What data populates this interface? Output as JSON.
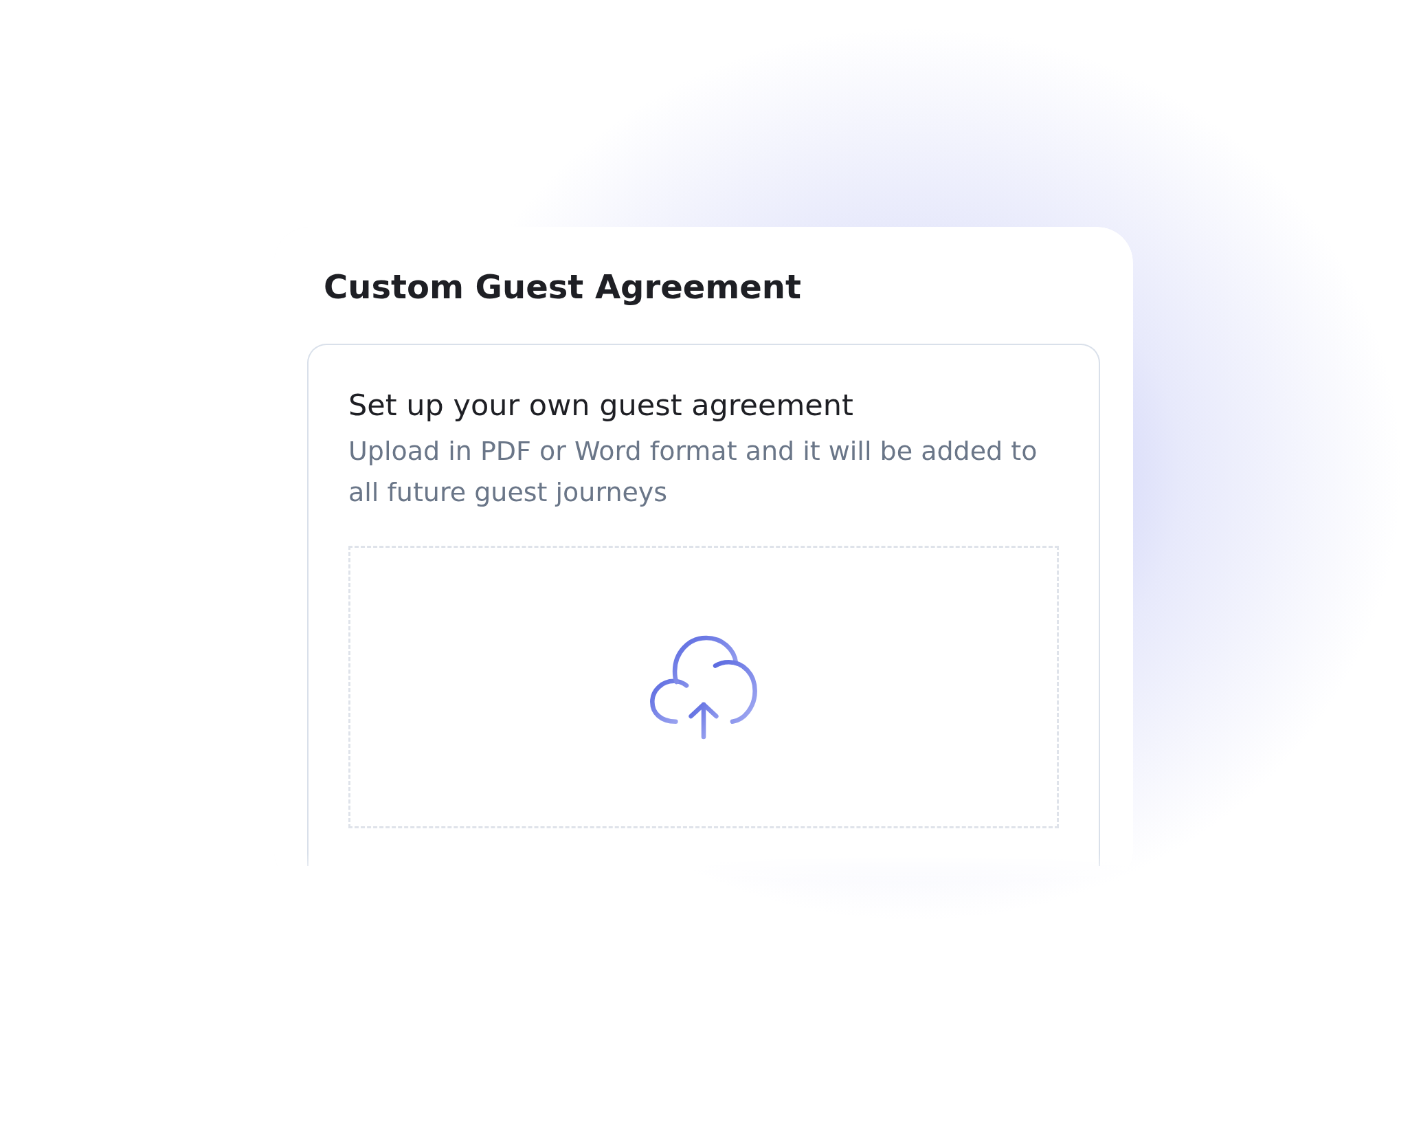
{
  "card": {
    "title": "Custom Guest Agreement",
    "panel": {
      "heading": "Set up your own guest agreement",
      "description": "Upload in PDF or Word format and it will be added to all future guest journeys"
    }
  }
}
